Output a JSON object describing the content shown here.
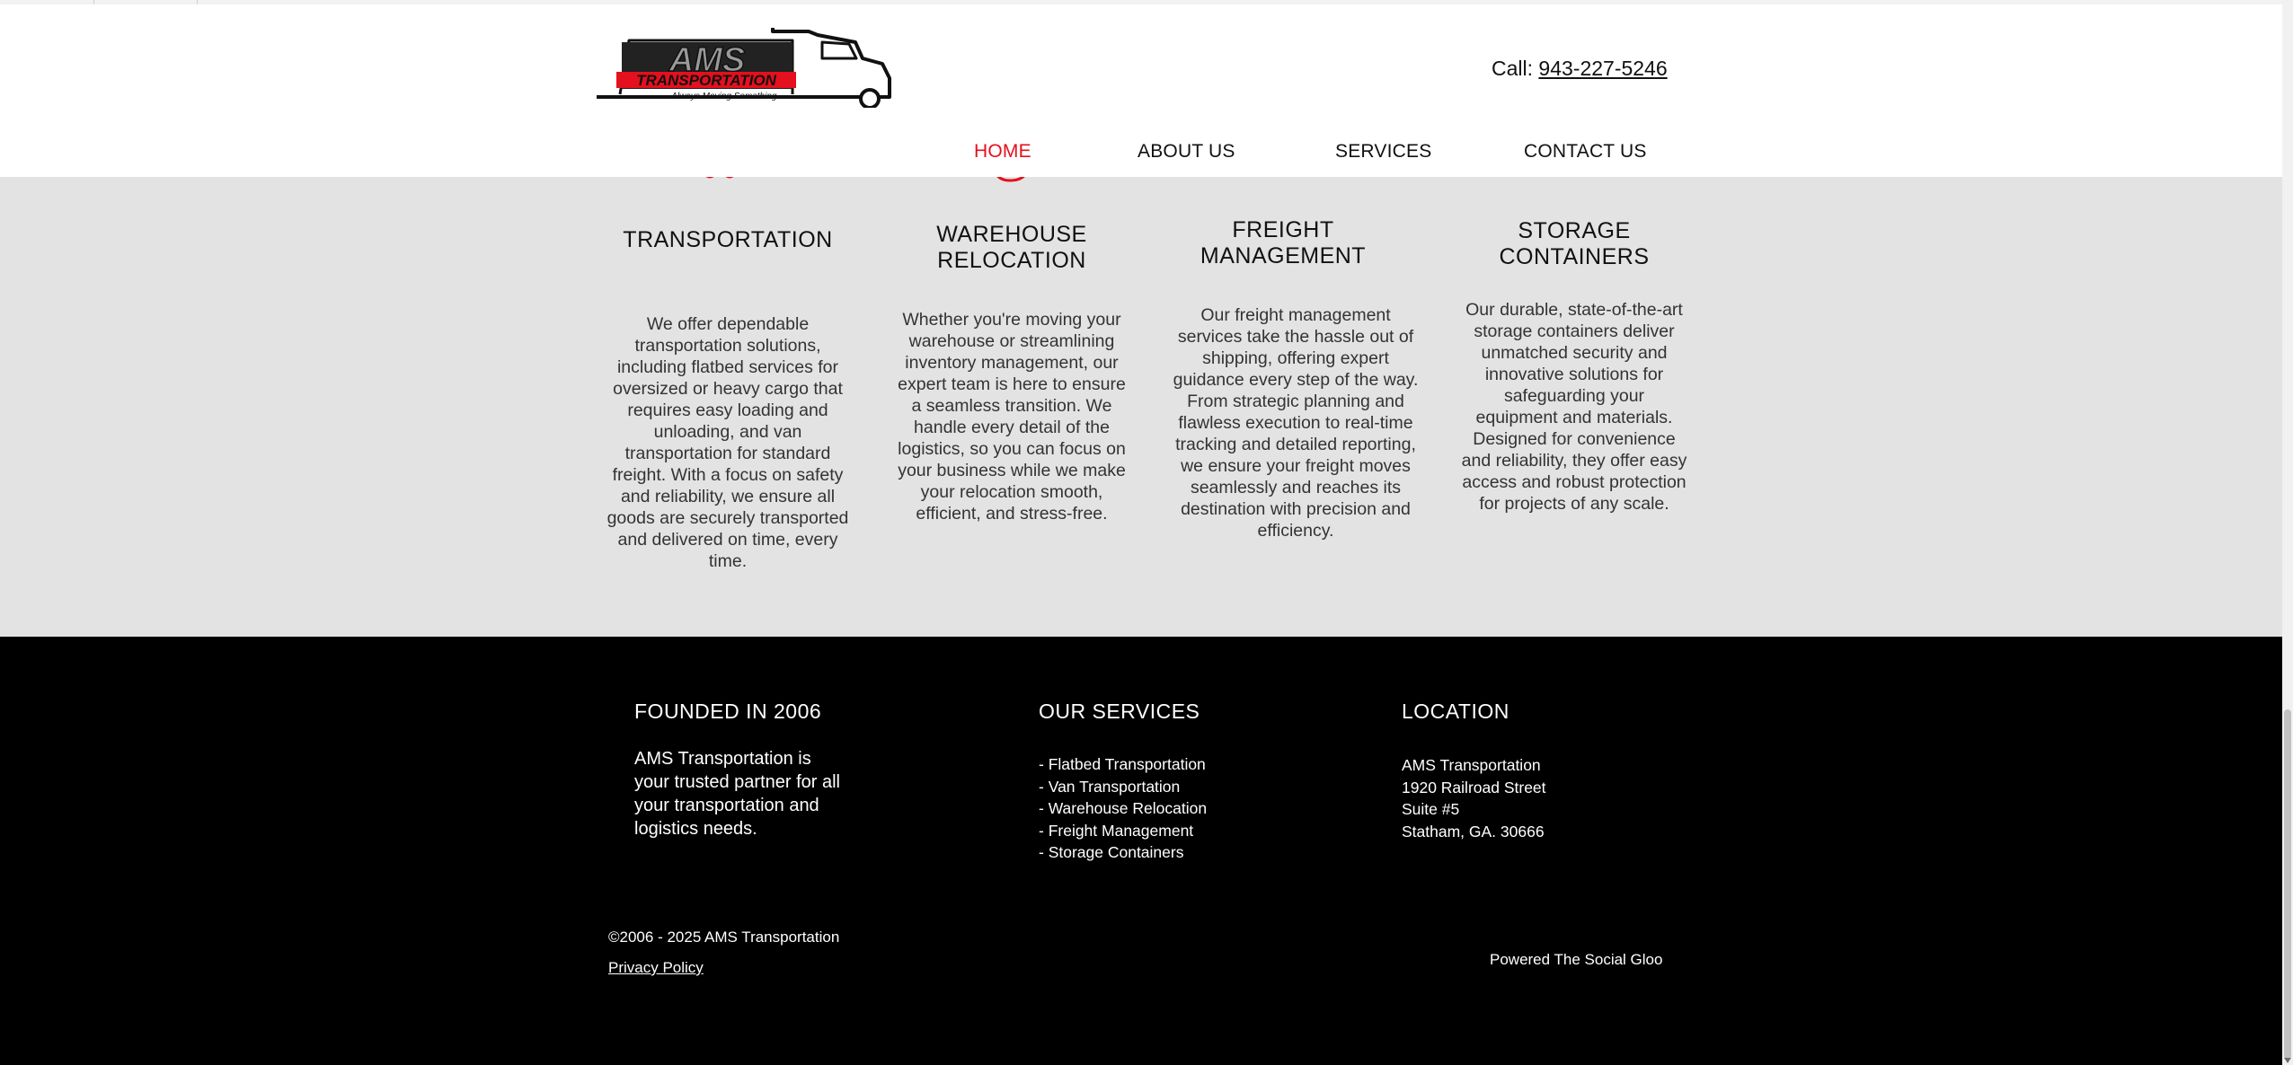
{
  "header": {
    "logo_text": "AMS",
    "logo_subtext": "TRANSPORTATION",
    "logo_tagline": "Always Moving Something...",
    "call_label": "Call:",
    "phone": "943-227-5246",
    "nav": [
      {
        "label": "HOME",
        "active": true
      },
      {
        "label": "ABOUT US",
        "active": false
      },
      {
        "label": "SERVICES",
        "active": false
      },
      {
        "label": "CONTACT US",
        "active": false
      }
    ]
  },
  "services": [
    {
      "title_lines": [
        "TRANSPORTATION"
      ],
      "text_lines": [
        "We offer dependable",
        "transportation solutions,",
        "including flatbed services for",
        "oversized or heavy cargo that",
        "requires easy loading and",
        "unloading, and van",
        "transportation for standard",
        "freight. With a focus on safety",
        "and reliability, we ensure all",
        "goods are securely transported",
        "and delivered on time, every",
        "time."
      ]
    },
    {
      "title_lines": [
        "WAREHOUSE",
        "RELOCATION"
      ],
      "text_lines": [
        "Whether you're moving your",
        "warehouse or streamlining",
        "inventory management, our",
        "expert team is here to ensure",
        "a seamless transition. We",
        "handle every detail of the",
        "logistics, so you can focus on",
        "your business while we make",
        "your relocation smooth,",
        "efficient, and stress-free."
      ]
    },
    {
      "title_lines": [
        "FREIGHT",
        "MANAGEMENT"
      ],
      "text_lines": [
        "Our freight management",
        "services take the hassle out of",
        "shipping, offering expert",
        "guidance every step of the way.",
        "From strategic planning and",
        "flawless execution to real-time",
        "tracking and detailed reporting,",
        "we ensure your freight moves",
        "seamlessly and reaches its",
        "destination with precision and",
        "efficiency."
      ]
    },
    {
      "title_lines": [
        "STORAGE",
        "CONTAINERS"
      ],
      "text_lines": [
        "Our durable, state-of-the-art",
        "storage containers deliver",
        "unmatched security and",
        "innovative solutions for",
        "safeguarding your",
        "equipment and materials.",
        "Designed for convenience",
        "and reliability, they offer easy",
        "access and robust protection",
        "for projects of any scale."
      ]
    }
  ],
  "footer": {
    "founded": {
      "heading": "FOUNDED IN 2006",
      "lines": [
        "AMS Transportation is",
        "your trusted partner for all",
        "your transportation and",
        "logistics needs."
      ]
    },
    "our_services": {
      "heading": "OUR SERVICES",
      "items": [
        "- Flatbed Transportation",
        "- Van Transportation",
        "- Warehouse Relocation",
        "- Freight Management",
        "- Storage Containers"
      ]
    },
    "location": {
      "heading": "LOCATION",
      "lines": [
        "AMS Transportation",
        "1920 Railroad Street",
        "Suite #5",
        "Statham, GA. 30666"
      ]
    },
    "copyright": "©2006 - 2025 AMS Transportation",
    "privacy_policy": "Privacy Policy",
    "powered_by": "Powered The Social Gloo"
  },
  "colors": {
    "accent_red": "#e4101d",
    "services_bg": "#e3e3e3",
    "footer_bg": "#000000"
  },
  "icons": [
    "truck-logo-icon",
    "transport-icon",
    "warehouse-icon",
    "freight-icon",
    "storage-icon"
  ]
}
